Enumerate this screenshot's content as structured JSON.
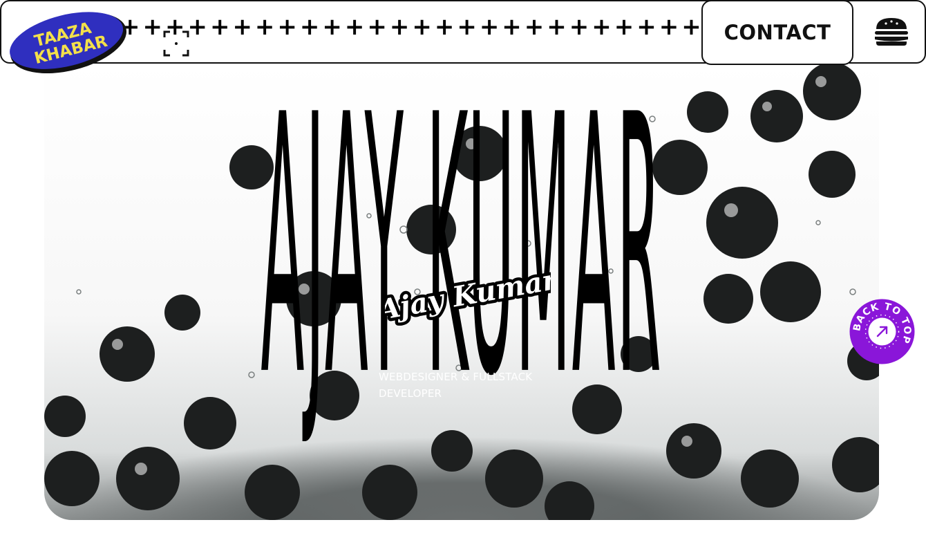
{
  "header": {
    "logo_text_line1": "TAAZA",
    "logo_text_line2": "KHABAR",
    "plus_pattern": "++++++++++++++++++++++++++++++++",
    "contact_label": "CONTACT"
  },
  "hero": {
    "big_name": "AJAY KUMAR",
    "signature": "Ajay Kumar",
    "subtitle_line1": "WEBDESIGNER & FULLSTACK",
    "subtitle_line2": "DEVELOPER"
  },
  "back_to_top": {
    "label": "BACK TO TOP"
  },
  "colors": {
    "logo_bg": "#2f2fbf",
    "logo_text": "#f3e04a",
    "back_top_bg": "#8a16d9",
    "ink": "#111111"
  },
  "icons": {
    "menu": "burger-icon",
    "cursor": "focus-frame-icon",
    "back_top": "arrow-up-right-icon"
  }
}
